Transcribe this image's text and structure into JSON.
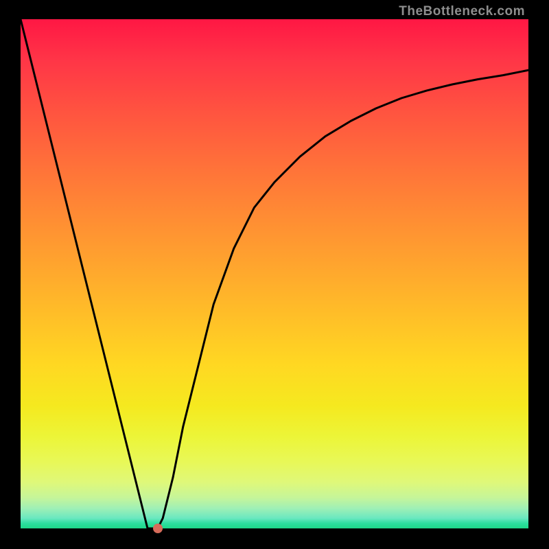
{
  "watermark": "TheBottleneck.com",
  "chart_data": {
    "type": "line",
    "title": "",
    "xlabel": "",
    "ylabel": "",
    "ylim": [
      0,
      100
    ],
    "xlim": [
      0,
      100
    ],
    "series": [
      {
        "name": "bottleneck-curve",
        "x": [
          0,
          3,
          6,
          9,
          12,
          15,
          18,
          21,
          24,
          25,
          26,
          27,
          28,
          30,
          32,
          35,
          38,
          42,
          46,
          50,
          55,
          60,
          65,
          70,
          75,
          80,
          85,
          90,
          95,
          100
        ],
        "values": [
          100,
          88,
          76,
          64,
          52,
          40,
          28,
          16,
          4,
          0,
          0,
          0,
          2,
          10,
          20,
          32,
          44,
          55,
          63,
          68,
          73,
          77,
          80,
          82.5,
          84.5,
          86,
          87.2,
          88.2,
          89,
          90
        ]
      }
    ],
    "marker": {
      "x": 27,
      "y": 0,
      "color": "#d66b5a"
    },
    "background_gradient": {
      "top": "#ff1744",
      "bottom": "#1ed888"
    }
  }
}
